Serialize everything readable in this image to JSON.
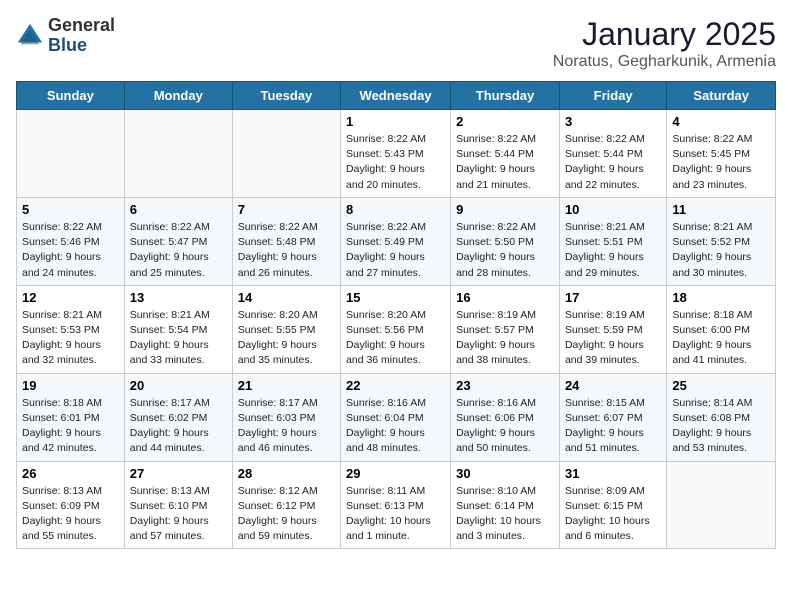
{
  "logo": {
    "general": "General",
    "blue": "Blue"
  },
  "title": "January 2025",
  "location": "Noratus, Gegharkunik, Armenia",
  "headers": [
    "Sunday",
    "Monday",
    "Tuesday",
    "Wednesday",
    "Thursday",
    "Friday",
    "Saturday"
  ],
  "weeks": [
    [
      {
        "day": "",
        "text": ""
      },
      {
        "day": "",
        "text": ""
      },
      {
        "day": "",
        "text": ""
      },
      {
        "day": "1",
        "text": "Sunrise: 8:22 AM\nSunset: 5:43 PM\nDaylight: 9 hours\nand 20 minutes."
      },
      {
        "day": "2",
        "text": "Sunrise: 8:22 AM\nSunset: 5:44 PM\nDaylight: 9 hours\nand 21 minutes."
      },
      {
        "day": "3",
        "text": "Sunrise: 8:22 AM\nSunset: 5:44 PM\nDaylight: 9 hours\nand 22 minutes."
      },
      {
        "day": "4",
        "text": "Sunrise: 8:22 AM\nSunset: 5:45 PM\nDaylight: 9 hours\nand 23 minutes."
      }
    ],
    [
      {
        "day": "5",
        "text": "Sunrise: 8:22 AM\nSunset: 5:46 PM\nDaylight: 9 hours\nand 24 minutes."
      },
      {
        "day": "6",
        "text": "Sunrise: 8:22 AM\nSunset: 5:47 PM\nDaylight: 9 hours\nand 25 minutes."
      },
      {
        "day": "7",
        "text": "Sunrise: 8:22 AM\nSunset: 5:48 PM\nDaylight: 9 hours\nand 26 minutes."
      },
      {
        "day": "8",
        "text": "Sunrise: 8:22 AM\nSunset: 5:49 PM\nDaylight: 9 hours\nand 27 minutes."
      },
      {
        "day": "9",
        "text": "Sunrise: 8:22 AM\nSunset: 5:50 PM\nDaylight: 9 hours\nand 28 minutes."
      },
      {
        "day": "10",
        "text": "Sunrise: 8:21 AM\nSunset: 5:51 PM\nDaylight: 9 hours\nand 29 minutes."
      },
      {
        "day": "11",
        "text": "Sunrise: 8:21 AM\nSunset: 5:52 PM\nDaylight: 9 hours\nand 30 minutes."
      }
    ],
    [
      {
        "day": "12",
        "text": "Sunrise: 8:21 AM\nSunset: 5:53 PM\nDaylight: 9 hours\nand 32 minutes."
      },
      {
        "day": "13",
        "text": "Sunrise: 8:21 AM\nSunset: 5:54 PM\nDaylight: 9 hours\nand 33 minutes."
      },
      {
        "day": "14",
        "text": "Sunrise: 8:20 AM\nSunset: 5:55 PM\nDaylight: 9 hours\nand 35 minutes."
      },
      {
        "day": "15",
        "text": "Sunrise: 8:20 AM\nSunset: 5:56 PM\nDaylight: 9 hours\nand 36 minutes."
      },
      {
        "day": "16",
        "text": "Sunrise: 8:19 AM\nSunset: 5:57 PM\nDaylight: 9 hours\nand 38 minutes."
      },
      {
        "day": "17",
        "text": "Sunrise: 8:19 AM\nSunset: 5:59 PM\nDaylight: 9 hours\nand 39 minutes."
      },
      {
        "day": "18",
        "text": "Sunrise: 8:18 AM\nSunset: 6:00 PM\nDaylight: 9 hours\nand 41 minutes."
      }
    ],
    [
      {
        "day": "19",
        "text": "Sunrise: 8:18 AM\nSunset: 6:01 PM\nDaylight: 9 hours\nand 42 minutes."
      },
      {
        "day": "20",
        "text": "Sunrise: 8:17 AM\nSunset: 6:02 PM\nDaylight: 9 hours\nand 44 minutes."
      },
      {
        "day": "21",
        "text": "Sunrise: 8:17 AM\nSunset: 6:03 PM\nDaylight: 9 hours\nand 46 minutes."
      },
      {
        "day": "22",
        "text": "Sunrise: 8:16 AM\nSunset: 6:04 PM\nDaylight: 9 hours\nand 48 minutes."
      },
      {
        "day": "23",
        "text": "Sunrise: 8:16 AM\nSunset: 6:06 PM\nDaylight: 9 hours\nand 50 minutes."
      },
      {
        "day": "24",
        "text": "Sunrise: 8:15 AM\nSunset: 6:07 PM\nDaylight: 9 hours\nand 51 minutes."
      },
      {
        "day": "25",
        "text": "Sunrise: 8:14 AM\nSunset: 6:08 PM\nDaylight: 9 hours\nand 53 minutes."
      }
    ],
    [
      {
        "day": "26",
        "text": "Sunrise: 8:13 AM\nSunset: 6:09 PM\nDaylight: 9 hours\nand 55 minutes."
      },
      {
        "day": "27",
        "text": "Sunrise: 8:13 AM\nSunset: 6:10 PM\nDaylight: 9 hours\nand 57 minutes."
      },
      {
        "day": "28",
        "text": "Sunrise: 8:12 AM\nSunset: 6:12 PM\nDaylight: 9 hours\nand 59 minutes."
      },
      {
        "day": "29",
        "text": "Sunrise: 8:11 AM\nSunset: 6:13 PM\nDaylight: 10 hours\nand 1 minute."
      },
      {
        "day": "30",
        "text": "Sunrise: 8:10 AM\nSunset: 6:14 PM\nDaylight: 10 hours\nand 3 minutes."
      },
      {
        "day": "31",
        "text": "Sunrise: 8:09 AM\nSunset: 6:15 PM\nDaylight: 10 hours\nand 6 minutes."
      },
      {
        "day": "",
        "text": ""
      }
    ]
  ]
}
